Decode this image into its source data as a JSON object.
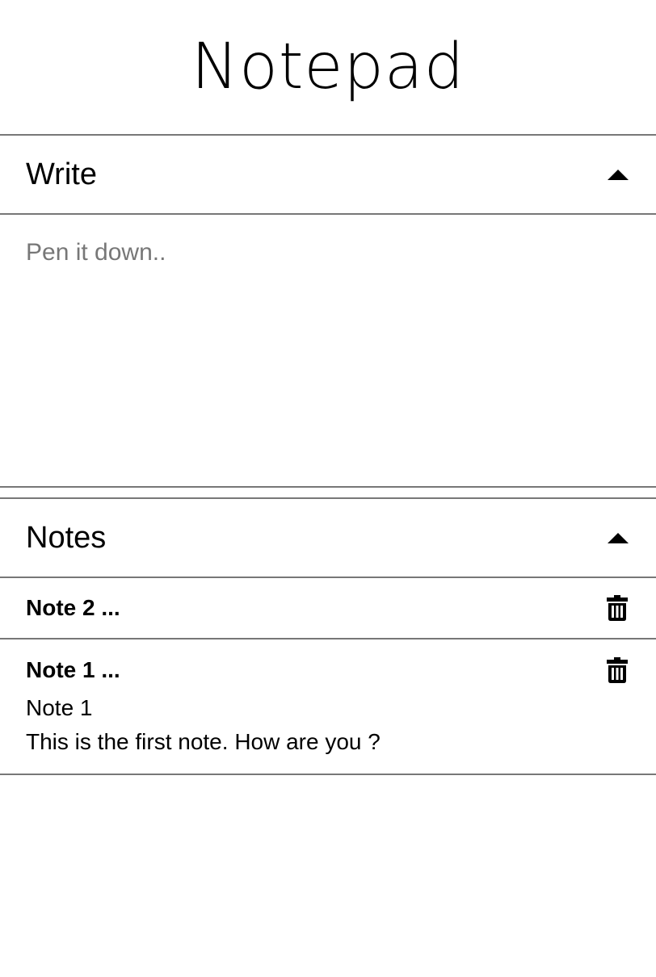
{
  "app": {
    "title": "Notepad"
  },
  "write": {
    "title": "Write",
    "toggle_icon": "caret-up-icon",
    "placeholder": "Pen it down..",
    "value": ""
  },
  "notes": {
    "title": "Notes",
    "toggle_icon": "caret-up-icon",
    "items": [
      {
        "title": "Note 2 ...",
        "delete_icon": "trash-icon",
        "expanded": false
      },
      {
        "title": "Note 1 ...",
        "delete_icon": "trash-icon",
        "expanded": true,
        "body_lines": [
          "Note 1",
          "This is the first note. How are you ?"
        ]
      }
    ]
  }
}
